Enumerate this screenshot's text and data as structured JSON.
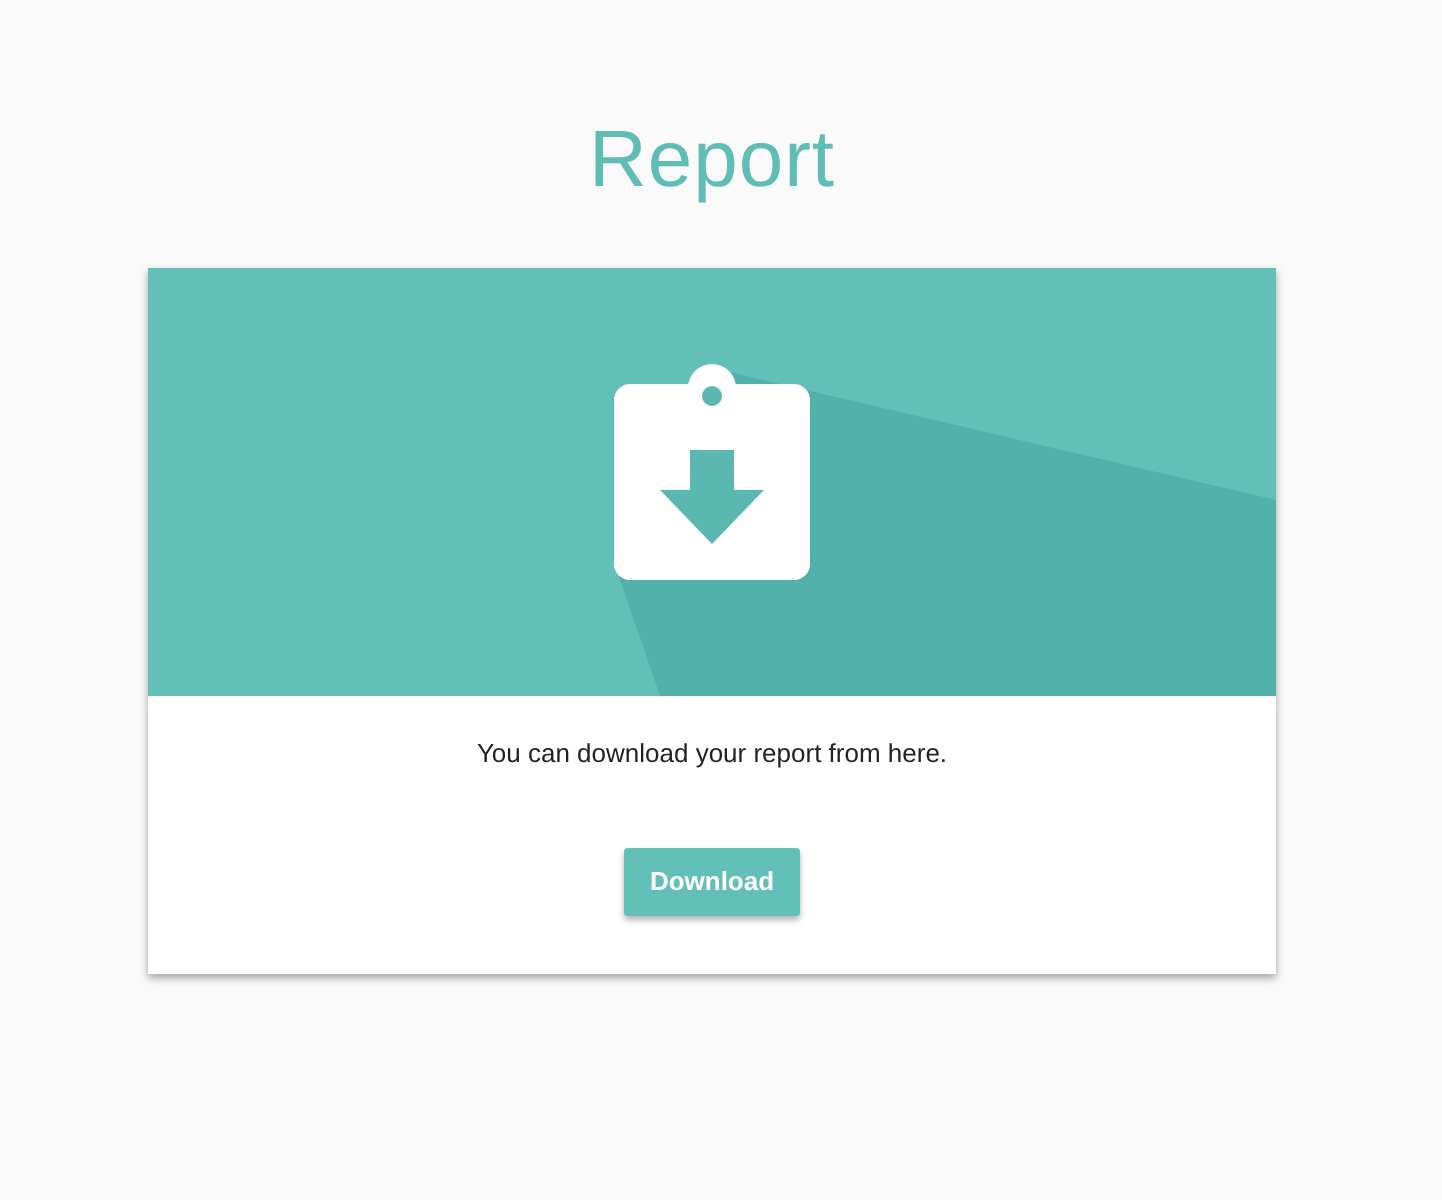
{
  "page": {
    "title": "Report"
  },
  "card": {
    "message": "You can download your report from here.",
    "button": "Download"
  }
}
